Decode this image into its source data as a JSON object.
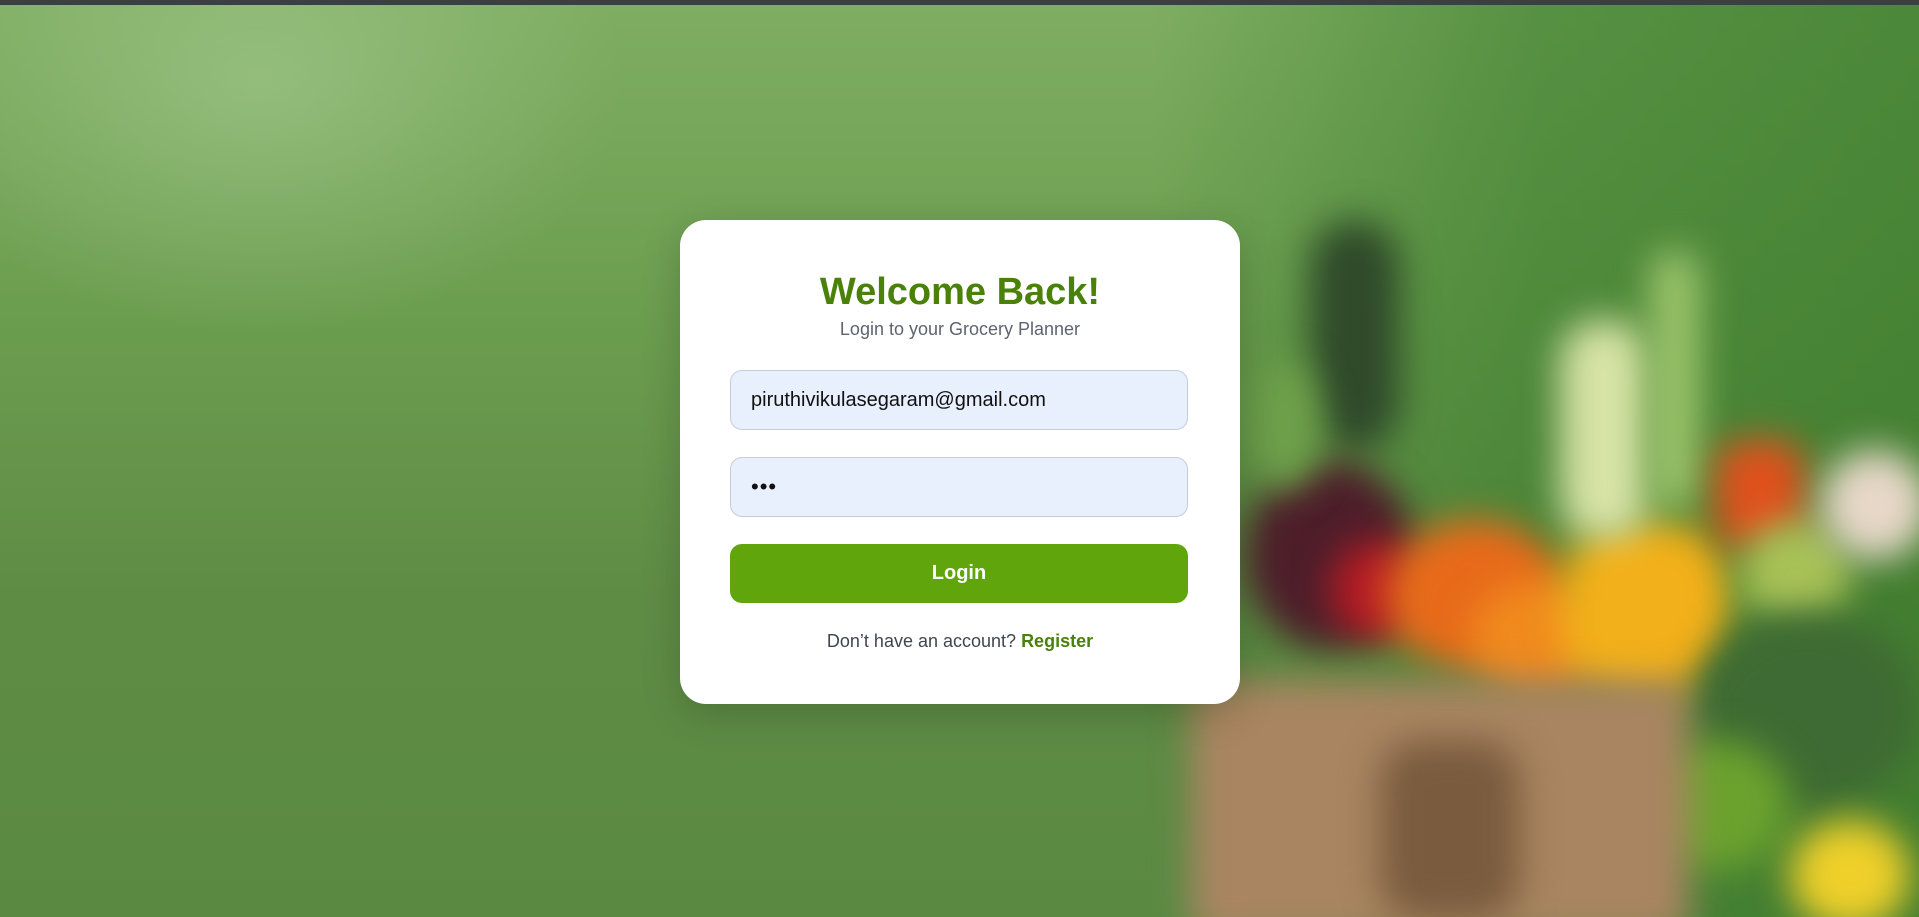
{
  "login": {
    "title": "Welcome Back!",
    "subtitle": "Login to your Grocery Planner",
    "email_value": "piruthivikulasegaram@gmail.com",
    "password_value": "abc",
    "button_label": "Login",
    "footer_prompt": "Don’t have an account?",
    "register_link": "Register"
  },
  "colors": {
    "accent": "#5fa50b",
    "title": "#4a8209",
    "input_bg": "#e8effd",
    "background": "#6b9d4f"
  },
  "icons": {
    "background_image": "blurred-grocery-bag-photo"
  }
}
